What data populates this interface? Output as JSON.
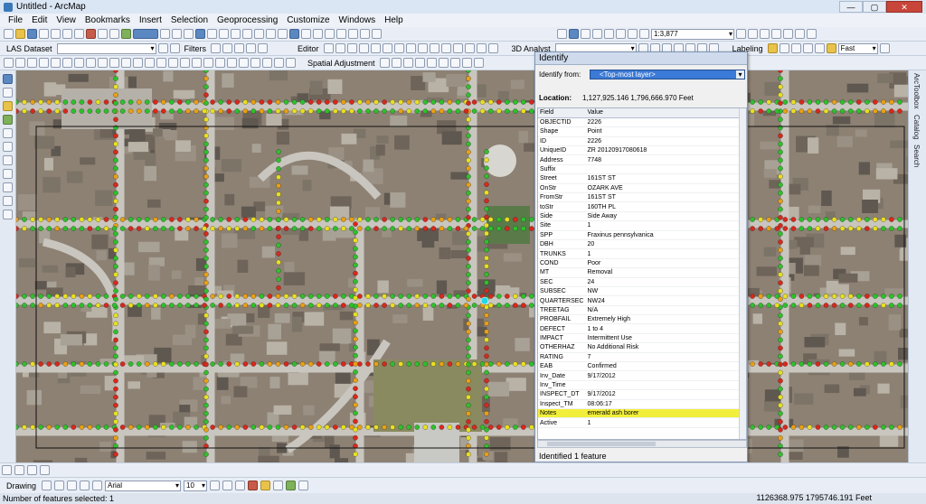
{
  "window": {
    "title": "Untitled - ArcMap"
  },
  "menu": [
    "File",
    "Edit",
    "View",
    "Bookmarks",
    "Insert",
    "Selection",
    "Geoprocessing",
    "Customize",
    "Windows",
    "Help"
  ],
  "toolbar": {
    "scale": "1:3,877",
    "las_label": "LAS Dataset",
    "filters_label": "Filters",
    "editor_label": "Editor",
    "spatial_adjustment_label": "Spatial Adjustment",
    "analyst_label": "3D Analyst",
    "labeling_label": "Labeling",
    "fast_label": "Fast"
  },
  "right_tabs": [
    "ArcToolbox",
    "Catalog",
    "Search"
  ],
  "identify": {
    "title": "Identify",
    "from_label": "Identify from:",
    "from_value": "<Top-most layer>",
    "location_label": "Location:",
    "location_value": "1,127,925.146  1,796,666.970 Feet",
    "col_field": "Field",
    "col_value": "Value",
    "rows": [
      [
        "OBJECTID",
        "2226"
      ],
      [
        "Shape",
        "Point"
      ],
      [
        "ID",
        "2226"
      ],
      [
        "UniqueID",
        "ZR 20120917080618"
      ],
      [
        "Address",
        "7748"
      ],
      [
        "Suffix",
        ""
      ],
      [
        "Street",
        "161ST ST"
      ],
      [
        "OnStr",
        "OZARK AVE"
      ],
      [
        "FromStr",
        "161ST ST"
      ],
      [
        "toStr",
        "160TH PL"
      ],
      [
        "Side",
        "Side Away"
      ],
      [
        "Site",
        "1"
      ],
      [
        "SPP",
        "Fraxinus pennsylvanica"
      ],
      [
        "DBH",
        "20"
      ],
      [
        "TRUNKS",
        "1"
      ],
      [
        "COND",
        "Poor"
      ],
      [
        "MT",
        "Removal"
      ],
      [
        "SEC",
        "24"
      ],
      [
        "SUBSEC",
        "NW"
      ],
      [
        "QUARTERSEC",
        "NW24"
      ],
      [
        "TREETAG",
        "N/A"
      ],
      [
        "PROBFAIL",
        "Extremely High"
      ],
      [
        "DEFECT",
        "1 to 4"
      ],
      [
        "IMPACT",
        "Intermittent Use"
      ],
      [
        "OTHERHAZ",
        "No Additional Risk"
      ],
      [
        "RATING",
        "7"
      ],
      [
        "EAB",
        "Confirmed"
      ],
      [
        "Inv_Date",
        "9/17/2012"
      ],
      [
        "Inv_Time",
        ""
      ],
      [
        "INSPECT_DT",
        "9/17/2012"
      ],
      [
        "Inspect_TM",
        "08:06:17"
      ],
      [
        "Notes",
        "emerald ash borer"
      ],
      [
        "Active",
        "1"
      ]
    ],
    "highlight_field": "Notes",
    "footer": "Identified 1 feature"
  },
  "drawing": {
    "label": "Drawing",
    "font": "Arial",
    "size": "10"
  },
  "status": {
    "left": "Number of features selected: 1",
    "coords": "1126368.975  1795746.191 Feet"
  },
  "colors": {
    "good": "#2ec02a",
    "fair": "#e8e020",
    "poor": "#e8a014",
    "bad": "#d8281c",
    "selected": "#20d8e8"
  }
}
